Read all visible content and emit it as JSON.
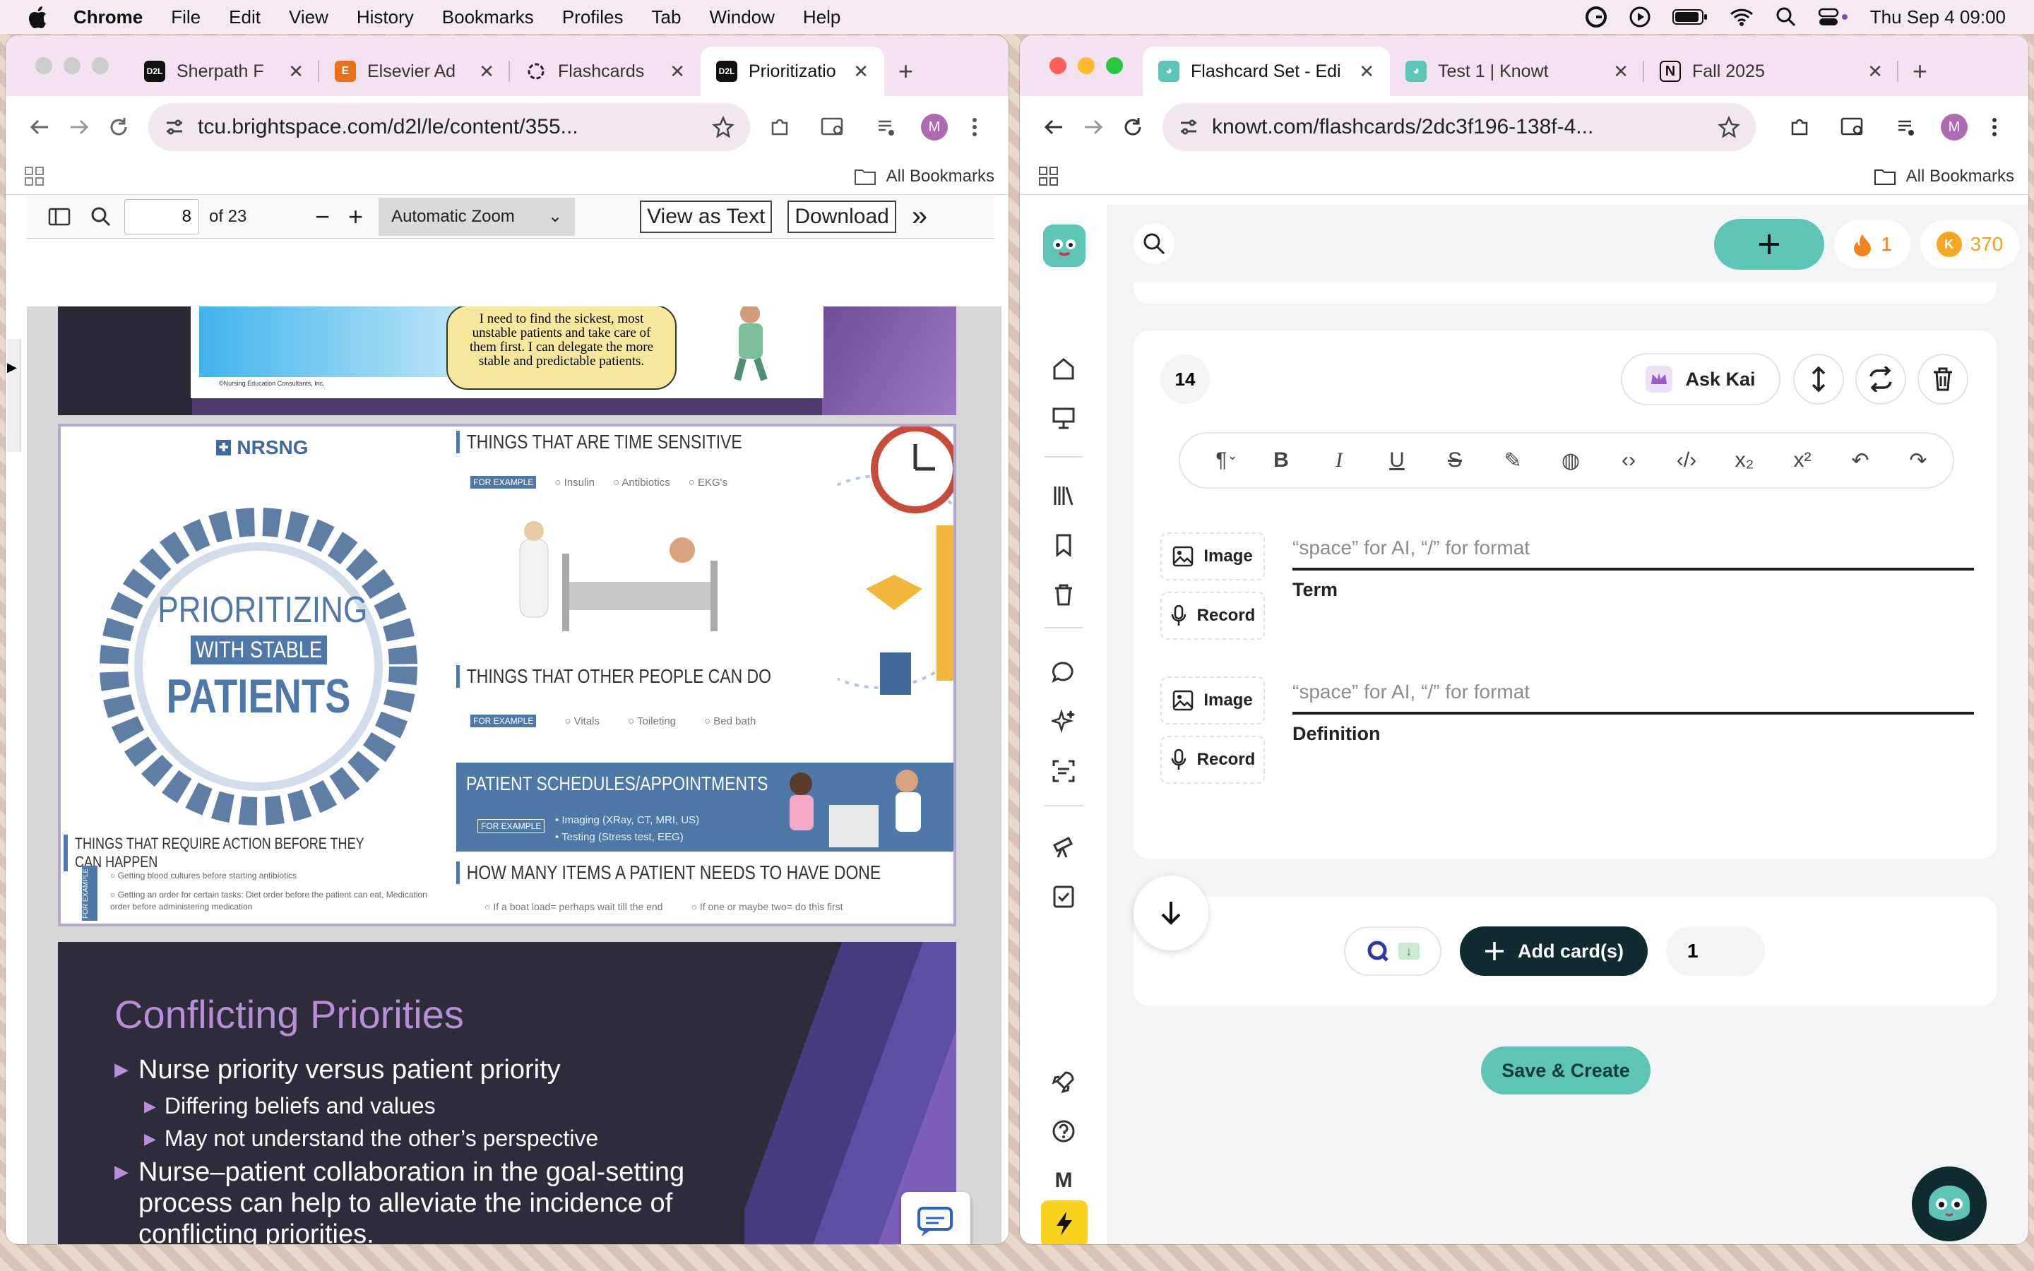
{
  "menubar": {
    "app": "Chrome",
    "items": [
      "File",
      "Edit",
      "View",
      "History",
      "Bookmarks",
      "Profiles",
      "Tab",
      "Window",
      "Help"
    ],
    "datetime": "Thu Sep 4  09:00"
  },
  "left_window": {
    "tabs": [
      {
        "label": "Sherpath F",
        "icon": "D2L"
      },
      {
        "label": "Elsevier Ad",
        "icon": "E"
      },
      {
        "label": "Flashcards",
        "icon": "openai"
      },
      {
        "label": "Prioritizatio",
        "icon": "D2L"
      }
    ],
    "url": "tcu.brightspace.com/d2l/le/content/355...",
    "bookmarks": "All Bookmarks",
    "avatar": "M",
    "pdf": {
      "page": "8",
      "of": "of 23",
      "zoom": "Automatic Zoom",
      "view_as_text": "View as Text",
      "download": "Download"
    },
    "slide_top": {
      "bubble": "I need to find the sickest, most unstable patients and take care of them first. I can delegate the more stable and predictable patients.",
      "footer": "©Nursing Education Consultants, Inc."
    },
    "infographic": {
      "brand": "NRSNG",
      "circle_line1": "PRIORITIZING",
      "circle_line2": "WITH STABLE",
      "circle_line3": "PATIENTS",
      "s1_title": "THINGS THAT ARE TIME SENSITIVE",
      "s1_tag": "FOR EXAMPLE",
      "s1_items": [
        "Insulin",
        "Antibiotics",
        "EKG's"
      ],
      "s2_title": "THINGS THAT OTHER PEOPLE CAN DO",
      "s2_tag": "FOR EXAMPLE",
      "s2_items": [
        "Vitals",
        "Toileting",
        "Bed bath"
      ],
      "s3_title": "PATIENT SCHEDULES/APPOINTMENTS",
      "s3_tag": "FOR EXAMPLE",
      "s3_items": [
        "Imaging (XRay, CT, MRI, US)",
        "Testing (Stress test, EEG)"
      ],
      "s4_title": "THINGS THAT REQUIRE ACTION BEFORE THEY CAN HAPPEN",
      "s4_tag": "FOR EXAMPLE",
      "s4_items": [
        "Getting blood cultures before starting antibiotics",
        "Getting an order for certain tasks: Diet order before the patient can eat, Medication order before administering medication"
      ],
      "s5_title": "HOW MANY ITEMS A PATIENT NEEDS TO HAVE DONE",
      "s5_items": [
        "If a boat load= perhaps wait till the end",
        "If one or maybe two= do this first"
      ]
    },
    "slide_bottom": {
      "title": "Conflicting Priorities",
      "b1": "Nurse priority versus patient priority",
      "b1a": "Differing beliefs and values",
      "b1b": "May not understand the other’s perspective",
      "b2": "Nurse–patient collaboration in the goal-setting process can help to alleviate the incidence of conflicting priorities."
    }
  },
  "right_window": {
    "tabs": [
      {
        "label": "Flashcard Set - Edi"
      },
      {
        "label": "Test 1 | Knowt"
      },
      {
        "label": "Fall 2025"
      }
    ],
    "url": "knowt.com/flashcards/2dc3f196-138f-4...",
    "bookmarks": "All Bookmarks",
    "avatar": "M",
    "header": {
      "streak": "1",
      "coins": "370"
    },
    "card": {
      "number": "14",
      "ask_kai": "Ask Kai",
      "image_label": "Image",
      "record_label": "Record",
      "placeholder": "“space” for AI, “/” for format",
      "term_label": "Term",
      "definition_label": "Definition"
    },
    "footer": {
      "add_cards": "Add card(s)",
      "count": "1",
      "save": "Save & Create"
    },
    "sidebar_letter": "M"
  }
}
